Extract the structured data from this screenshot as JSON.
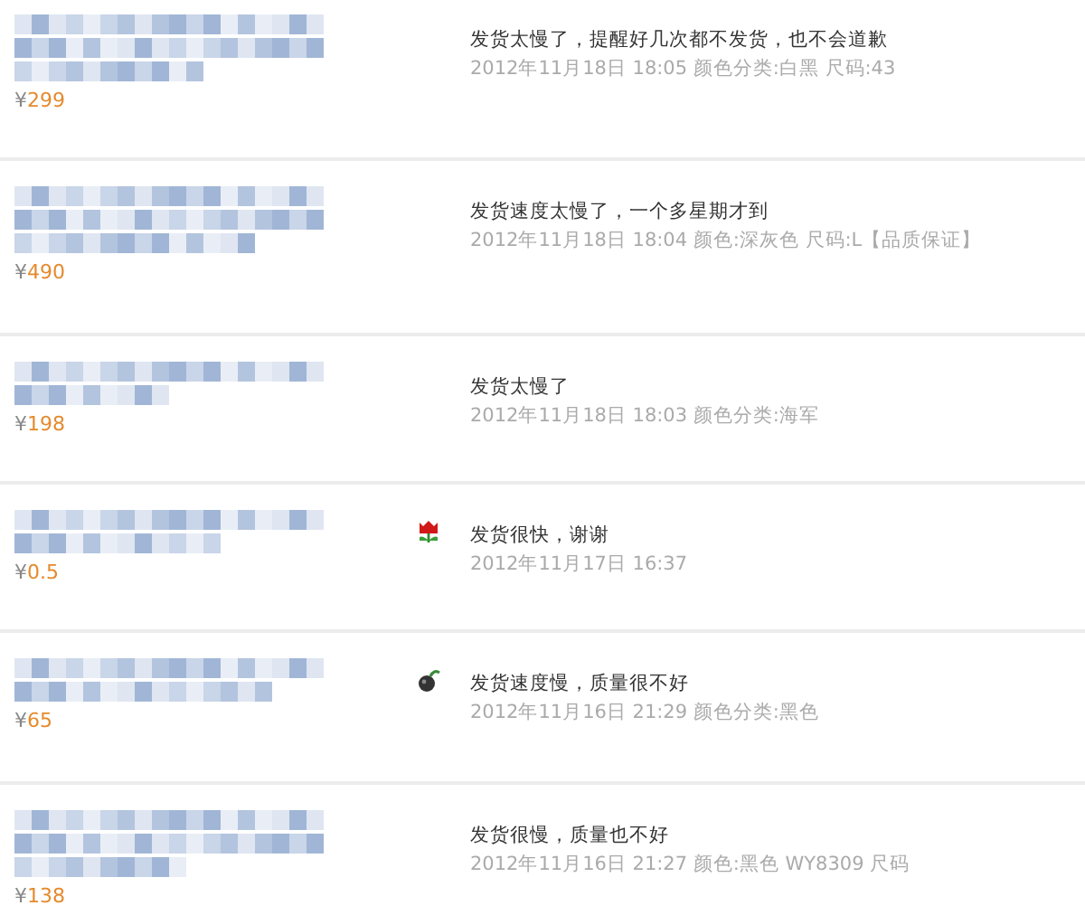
{
  "reviews": [
    {
      "currency": "¥",
      "price": "299",
      "comment": "发货太慢了，提醒好几次都不发货，也不会道歉",
      "meta": "2012年11月18日 18:05 颜色分类:白黑  尺码:43"
    },
    {
      "currency": "¥",
      "price": "490",
      "comment": "发货速度太慢了，一个多星期才到",
      "meta": "2012年11月18日 18:04 颜色:深灰色  尺码:L【品质保证】"
    },
    {
      "currency": "¥",
      "price": "198",
      "comment": "发货太慢了",
      "meta": "2012年11月18日 18:03 颜色分类:海军"
    },
    {
      "currency": "¥",
      "price": "0.5",
      "badge": {
        "kind": "flower"
      },
      "comment": "发货很快，谢谢",
      "meta": "2012年11月17日 16:37"
    },
    {
      "currency": "¥",
      "price": "65",
      "badge": {
        "kind": "bomb"
      },
      "comment": "发货速度慢，质量很不好",
      "meta": "2012年11月16日 21:29 颜色分类:黑色"
    },
    {
      "currency": "¥",
      "price": "138",
      "comment": "发货很慢，质量也不好",
      "meta": "2012年11月16日 21:27 颜色:黑色 WY8309  尺码"
    }
  ]
}
